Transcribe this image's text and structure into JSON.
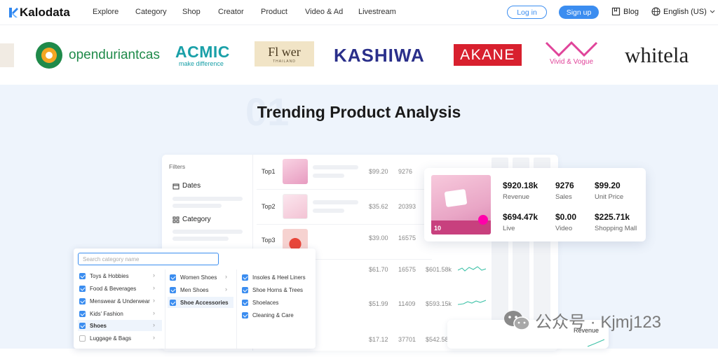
{
  "nav": {
    "logo": "Kalodata",
    "items": [
      "Explore",
      "Category",
      "Shop",
      "Creator",
      "Product",
      "Video & Ad",
      "Livestream"
    ],
    "login": "Log in",
    "signup": "Sign up",
    "blog": "Blog",
    "language": "English (US)"
  },
  "brands": {
    "b1": "opendurian",
    "b1_suffix": "tcas",
    "b2_top": "ACMIC",
    "b2_bottom": "make difference",
    "b3_main": "Fl wer",
    "b3_sub": "THAILAND",
    "b4": "KASHIWA",
    "b5": "AKANE",
    "b6": "Vivid & Vogue",
    "b7": "whitela"
  },
  "hero": {
    "number": "01",
    "title": "Trending Product Analysis"
  },
  "filters": {
    "heading": "Filters",
    "dates": "Dates",
    "category": "Category"
  },
  "rows": [
    {
      "rank": "Top1",
      "price": "$99.20",
      "sales": "9276",
      "revenue": "$920.18k"
    },
    {
      "rank": "Top2",
      "price": "$35.62",
      "sales": "20393",
      "revenue": ""
    },
    {
      "rank": "Top3",
      "price": "$39.00",
      "sales": "16575",
      "revenue": ""
    },
    {
      "rank": "",
      "price": "$61.70",
      "sales": "16575",
      "revenue": "$601.58k"
    },
    {
      "rank": "",
      "price": "$51.99",
      "sales": "11409",
      "revenue": "$593.15k"
    },
    {
      "rank": "",
      "price": "$17.12",
      "sales": "37701",
      "revenue": "$542.58"
    }
  ],
  "popup": {
    "stats": [
      {
        "value": "$920.18k",
        "label": "Revenue"
      },
      {
        "value": "9276",
        "label": "Sales"
      },
      {
        "value": "$99.20",
        "label": "Unit Price"
      },
      {
        "value": "$694.47k",
        "label": "Live"
      },
      {
        "value": "$0.00",
        "label": "Video"
      },
      {
        "value": "$225.71k",
        "label": "Shopping Mall"
      }
    ],
    "badge": "10"
  },
  "categories": {
    "search_placeholder": "Search category name",
    "col1": [
      "Toys & Hobbies",
      "Food & Beverages",
      "Menswear & Underwear",
      "Kids' Fashion",
      "Shoes",
      "Luggage & Bags"
    ],
    "col2": [
      "Women Shoes",
      "Men Shoes",
      "Shoe Accessories"
    ],
    "col3": [
      "Insoles & Heel Liners",
      "Shoe Horns & Trees",
      "Shoelaces",
      "Cleaning & Care"
    ]
  },
  "revenue_card": {
    "label": "Revenue"
  },
  "watermark": "公众号 · Kjmj123",
  "colors": {
    "accent": "#3b8df0",
    "hero_bg": "#eef4fc"
  }
}
